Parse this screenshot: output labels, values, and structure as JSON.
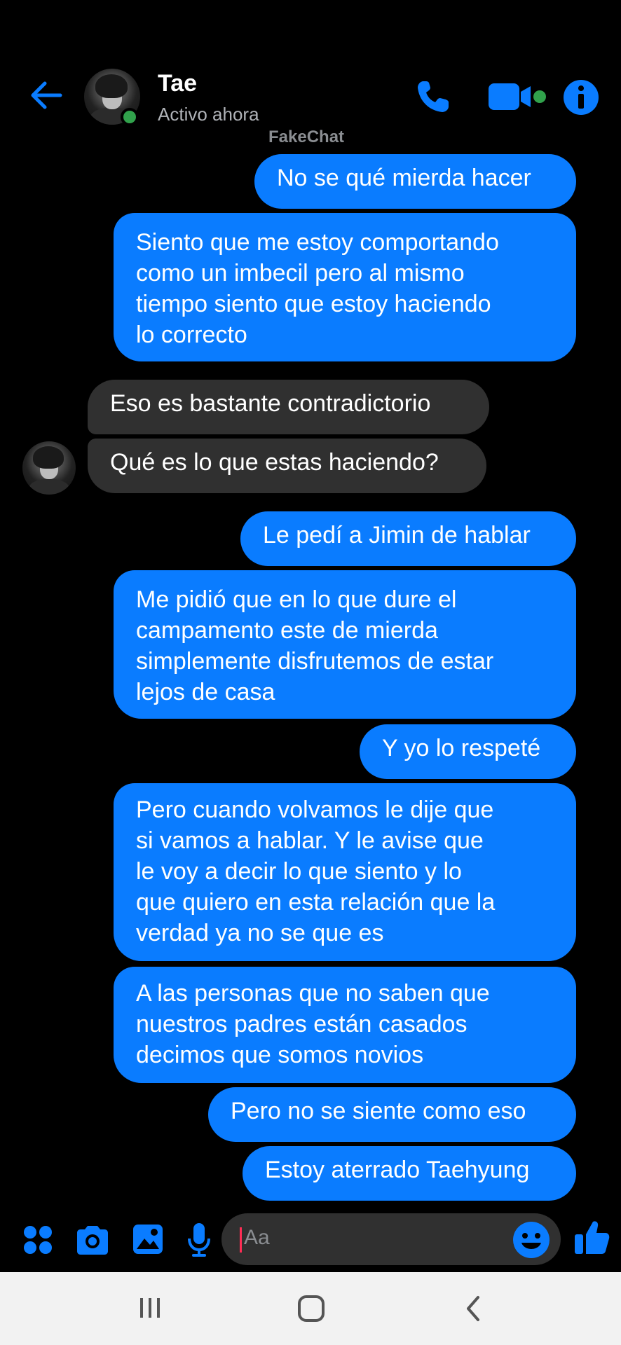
{
  "colors": {
    "accent": "#0a7cff",
    "incoming_bubble": "#303030",
    "online": "#31a24c"
  },
  "header": {
    "contact_name": "Tae",
    "status": "Activo ahora",
    "watermark": "FakeChat",
    "icons": [
      "back-arrow-icon",
      "phone-icon",
      "video-icon",
      "info-icon"
    ]
  },
  "messages": [
    {
      "direction": "out",
      "text": [
        "No se qué mierda hacer"
      ]
    },
    {
      "direction": "out",
      "text": [
        "Siento que me estoy comportando",
        "como un imbecil pero al mismo",
        "tiempo siento que estoy haciendo",
        "lo correcto"
      ]
    },
    {
      "direction": "in",
      "text": [
        "Eso es bastante contradictorio"
      ]
    },
    {
      "direction": "in",
      "text": [
        "Qué es lo que estas haciendo?"
      ]
    },
    {
      "direction": "out",
      "text": [
        "Le pedí a Jimin de hablar"
      ]
    },
    {
      "direction": "out",
      "text": [
        "Me pidió que en lo que dure el",
        "campamento este de mierda",
        "simplemente disfrutemos de estar",
        "lejos de casa"
      ]
    },
    {
      "direction": "out",
      "text": [
        "Y yo lo respeté"
      ]
    },
    {
      "direction": "out",
      "text": [
        "Pero cuando volvamos le dije que",
        "si vamos a hablar. Y le avise que",
        "le voy a decir lo que siento y lo",
        "que quiero en esta relación que la",
        "verdad ya no se que es"
      ]
    },
    {
      "direction": "out",
      "text": [
        "A las personas que no saben que",
        "nuestros padres están casados",
        "decimos que somos novios"
      ]
    },
    {
      "direction": "out",
      "text": [
        "Pero no se siente como eso"
      ]
    },
    {
      "direction": "out",
      "text": [
        "Estoy aterrado Taehyung"
      ]
    }
  ],
  "composer": {
    "placeholder": "Aa",
    "icons": [
      "apps-icon",
      "camera-icon",
      "gallery-icon",
      "microphone-icon",
      "emoji-icon",
      "thumbs-up-icon"
    ]
  },
  "system_nav": {
    "icons": [
      "recent-apps-icon",
      "home-icon",
      "back-icon"
    ]
  }
}
